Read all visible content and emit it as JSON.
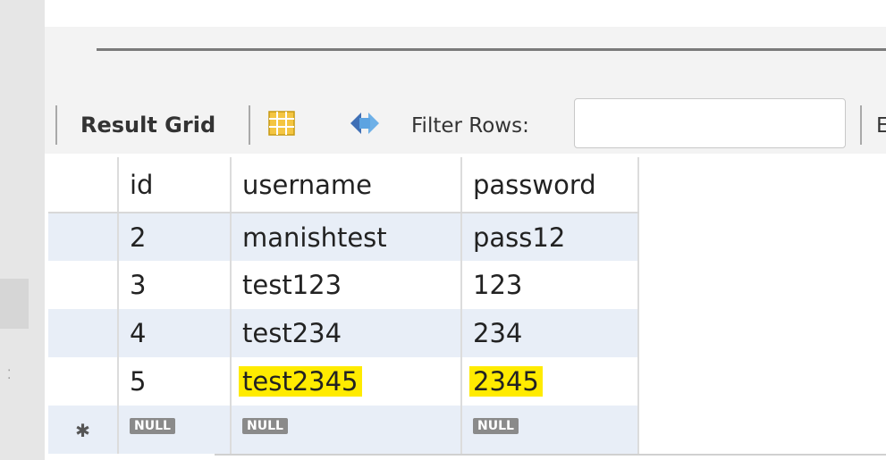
{
  "toolbar": {
    "result_label": "Result Grid",
    "filter_label": "Filter Rows:",
    "filter_value": "",
    "clipped_label": "E"
  },
  "table": {
    "columns": [
      "id",
      "username",
      "password"
    ],
    "rows": [
      {
        "id": "2",
        "username": "manishtest",
        "password": "pass12"
      },
      {
        "id": "3",
        "username": "test123",
        "password": "123"
      },
      {
        "id": "4",
        "username": "test234",
        "password": "234"
      },
      {
        "id": "5",
        "username": "test2345",
        "password": "2345",
        "highlighted": true
      }
    ],
    "new_row": {
      "marker": "✱",
      "id": "NULL",
      "username": "NULL",
      "password": "NULL"
    }
  },
  "icons": {
    "grid": "grid-view-icon",
    "refresh": "refresh-icon",
    "new_row": "new-row-star-icon"
  },
  "colors": {
    "highlight": "#ffeb00",
    "row_alt": "#e8eef7",
    "null_badge": "#8a8a8a"
  }
}
